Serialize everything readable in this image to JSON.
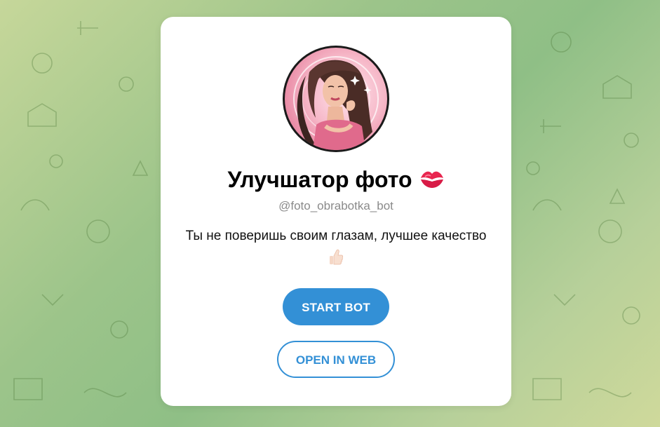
{
  "bot": {
    "name": "Улучшатор фото",
    "name_emoji": "kiss-mark-icon",
    "username": "@foto_obrabotka_bot",
    "description": "Ты не поверишь своим глазам, лучшее качество",
    "description_emoji": "thumbs-up-icon"
  },
  "buttons": {
    "start": "START BOT",
    "web": "OPEN IN WEB"
  },
  "colors": {
    "accent": "#3390d6",
    "card": "#ffffff",
    "background": "#9cc48a"
  }
}
